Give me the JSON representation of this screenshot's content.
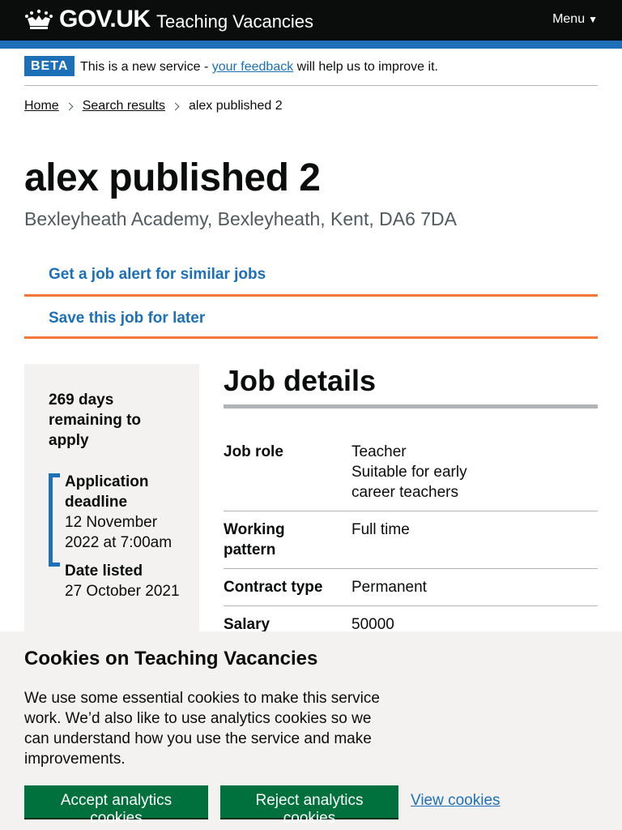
{
  "header": {
    "logo_icon": "crown-icon",
    "logotype": "GOV.UK",
    "service_name": "Teaching Vacancies",
    "menu_label": "Menu",
    "menu_caret": "▼"
  },
  "phase_banner": {
    "tag": "BETA",
    "text_before": "This is a new service - ",
    "link": "your feedback",
    "text_after": " will help us to improve it."
  },
  "breadcrumbs": [
    {
      "label": "Home"
    },
    {
      "label": "Search results"
    },
    {
      "label": "alex published 2"
    }
  ],
  "job": {
    "title": "alex published 2",
    "location": "Bexleyheath Academy, Bexleyheath, Kent, DA6 7DA"
  },
  "actions": {
    "job_alert": "Get a job alert for similar jobs",
    "save_job": "Save this job for later"
  },
  "sidebar": {
    "remaining": "269 days remaining to apply",
    "deadline_label": "Application deadline",
    "deadline_value": "12 November 2022 at 7:00am",
    "listed_label": "Date listed",
    "listed_value": "27 October 2021"
  },
  "job_details": {
    "heading": "Job details",
    "rows": [
      {
        "key": "Job role",
        "value_lines": [
          "Teacher",
          "Suitable for early career teachers"
        ]
      },
      {
        "key": "Working pattern",
        "value": "Full time"
      },
      {
        "key": "Contract type",
        "value": "Permanent"
      },
      {
        "key": "Salary",
        "value": "50000"
      }
    ]
  },
  "cookie_banner": {
    "heading": "Cookies on Teaching Vacancies",
    "body": "We use some essential cookies to make this service work. We’d also like to use analytics cookies so we can understand how you use the service and make improvements.",
    "accept_label": "Accept analytics cookies",
    "reject_label": "Reject analytics cookies",
    "view_label": "View cookies"
  },
  "colors": {
    "header_bg": "#0b0c0c",
    "brand_blue": "#1d70b8",
    "action_underline": "#f47738",
    "button_green": "#00703c",
    "panel_grey": "#f3f2f1"
  }
}
